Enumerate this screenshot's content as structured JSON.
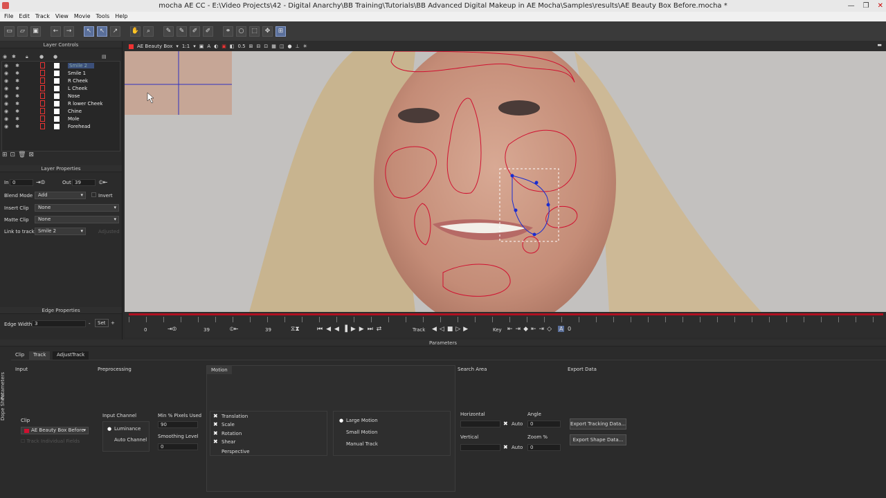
{
  "window": {
    "title": "mocha AE CC - E:\\Video Projects\\42 - Digital Anarchy\\BB Training\\Tutorials\\BB Advanced Digital Makeup in AE Mocha\\Samples\\results\\AE Beauty Box Before.mocha *"
  },
  "menu": [
    "File",
    "Edit",
    "Track",
    "View",
    "Movie",
    "Tools",
    "Help"
  ],
  "layer_controls": {
    "title": "Layer Controls",
    "layers": [
      "Smile 2",
      "Smile 1",
      "R Cheek",
      "L Cheek",
      "Nose",
      "R lower Cheek",
      "Chine",
      "Mole",
      "Forehead"
    ]
  },
  "layer_properties": {
    "title": "Layer Properties",
    "in_label": "In",
    "in_value": "0",
    "out_label": "Out",
    "out_value": "39",
    "blend_mode_label": "Blend Mode",
    "blend_mode": "Add",
    "invert_label": "Invert",
    "insert_clip_label": "Insert Clip",
    "insert_clip": "None",
    "matte_clip_label": "Matte Clip",
    "matte_clip": "None",
    "link_label": "Link to track",
    "link_value": "Smile 2",
    "adjusted_label": "Adjusted"
  },
  "edge_properties": {
    "title": "Edge Properties",
    "edge_width_label": "Edge Width",
    "edge_width": "3",
    "set_label": "Set"
  },
  "viewer_bar": {
    "clip": "AE Beauty Box",
    "zoom": "1:1",
    "opacity": "0.5"
  },
  "timeline": {
    "start": "0",
    "in": "39",
    "out": "39",
    "track_label": "Track",
    "key_label": "Key"
  },
  "parameters": {
    "title": "Parameters",
    "tabs": [
      "Clip",
      "Track",
      "AdjustTrack"
    ],
    "side_tabs": [
      "Parameters",
      "Dope Sheet"
    ],
    "input": {
      "title": "Input",
      "clip_label": "Clip",
      "clip_value": "AE Beauty Box Before",
      "track_fields": "Track Individual Fields"
    },
    "preprocessing": {
      "title": "Preprocessing",
      "input_channel_label": "Input Channel",
      "luminance": "Luminance",
      "auto_channel": "Auto Channel",
      "min_pixels_label": "Min % Pixels Used",
      "min_pixels": "90",
      "smoothing_label": "Smoothing Level",
      "smoothing": "0"
    },
    "motion": {
      "title": "Motion",
      "options": [
        "Translation",
        "Scale",
        "Rotation",
        "Shear",
        "Perspective"
      ],
      "modes": [
        "Large Motion",
        "Small Motion",
        "Manual Track"
      ]
    },
    "search_area": {
      "title": "Search Area",
      "horizontal_label": "Horizontal",
      "vertical_label": "Vertical",
      "angle_label": "Angle",
      "angle": "0",
      "zoom_label": "Zoom %",
      "zoom": "0",
      "auto": "Auto"
    },
    "export_data": {
      "title": "Export Data",
      "tracking_button": "Export Tracking Data...",
      "shape_button": "Export Shape Data..."
    }
  }
}
